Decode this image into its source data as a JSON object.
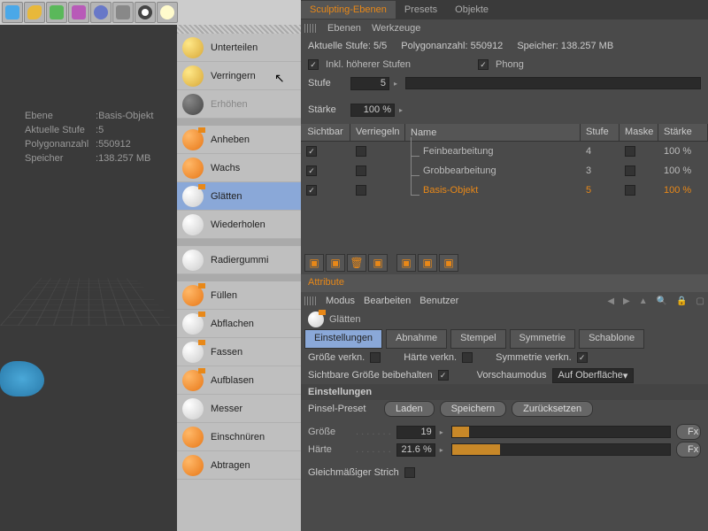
{
  "info": {
    "l_ebene": "Ebene",
    "l_stufe": "Aktuelle Stufe",
    "l_poly": "Polygonanzahl",
    "l_mem": "Speicher",
    "ebene": "Basis-Objekt",
    "stufe": "5",
    "poly": "550912",
    "mem": "138.257 MB"
  },
  "menu": {
    "unterteilen": "Unterteilen",
    "verringern": "Verringern",
    "erhoehen": "Erhöhen",
    "anheben": "Anheben",
    "wachs": "Wachs",
    "glaetten": "Glätten",
    "wiederholen": "Wiederholen",
    "radier": "Radiergummi",
    "fuellen": "Füllen",
    "abflachen": "Abflachen",
    "fassen": "Fassen",
    "aufblasen": "Aufblasen",
    "messer": "Messer",
    "einschnueren": "Einschnüren",
    "abtragen": "Abtragen"
  },
  "panel": {
    "tabs": {
      "sculpt": "Sculpting-Ebenen",
      "presets": "Presets",
      "objekte": "Objekte"
    },
    "sub": {
      "ebenen": "Ebenen",
      "werkzeuge": "Werkzeuge"
    },
    "stats": {
      "stufe_l": "Aktuelle Stufe:",
      "stufe_v": "5/5",
      "poly_l": "Polygonanzahl:",
      "poly_v": "550912",
      "mem_l": "Speicher:",
      "mem_v": "138.257 MB"
    },
    "inkl": "Inkl. höherer Stufen",
    "phong": "Phong",
    "stufe_l": "Stufe",
    "stufe_v": "5",
    "staerke_l": "Stärke",
    "staerke_v": "100 %",
    "head": {
      "vis": "Sichtbar",
      "lock": "Verriegeln",
      "name": "Name",
      "lvl": "Stufe",
      "mask": "Maske",
      "str": "Stärke"
    },
    "rows": [
      {
        "name": "Feinbearbeitung",
        "lvl": "4",
        "str": "100 %",
        "hl": false
      },
      {
        "name": "Grobbearbeitung",
        "lvl": "3",
        "str": "100 %",
        "hl": false
      },
      {
        "name": "Basis-Objekt",
        "lvl": "5",
        "str": "100 %",
        "hl": true
      }
    ]
  },
  "attr": {
    "title": "Attribute",
    "modus": "Modus",
    "bearb": "Bearbeiten",
    "benutzer": "Benutzer",
    "tool": "Glätten",
    "tabs": {
      "einst": "Einstellungen",
      "abn": "Abnahme",
      "stemp": "Stempel",
      "sym": "Symmetrie",
      "scha": "Schablone"
    },
    "groesse_v": "Größe verkn.",
    "haerte_v": "Härte verkn.",
    "sym_v": "Symmetrie verkn.",
    "sicht": "Sichtbare Größe beibehalten",
    "vorschau_l": "Vorschaumodus",
    "vorschau_v": "Auf Oberfläche",
    "sect": "Einstellungen",
    "preset_l": "Pinsel-Preset",
    "laden": "Laden",
    "speichern": "Speichern",
    "zurueck": "Zurücksetzen",
    "groesse_l": "Größe",
    "groesse_n": "19",
    "haerte_l": "Härte",
    "haerte_n": "21.6 %",
    "gleich": "Gleichmäßiger Strich",
    "fx": "Fx"
  }
}
